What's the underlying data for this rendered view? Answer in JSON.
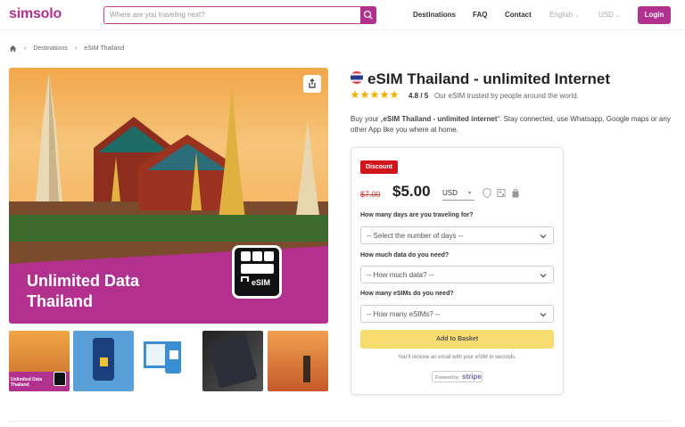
{
  "brand": {
    "logo": "simsolo"
  },
  "search": {
    "placeholder": "Where are you traveling next?"
  },
  "nav": {
    "destinations": "Destinations",
    "faq": "FAQ",
    "contact": "Contact",
    "language": "English",
    "currency": "USD",
    "login": "Login"
  },
  "breadcrumb": {
    "items": [
      "Destinations",
      "eSIM Thailand"
    ]
  },
  "hero": {
    "title_line1": "Unlimited Data",
    "title_line2": "Thailand",
    "card_label": "eSIM"
  },
  "thumbnails": {
    "first_label_line1": "Unlimited Data",
    "first_label_line2": "Thailand"
  },
  "product": {
    "title": "eSIM Thailand - unlimited Internet",
    "rating": "4.8 / 5",
    "rating_note": "Our eSIM trusted by people around the world.",
    "desc_prefix": "Buy your „",
    "desc_bold": "eSIM Thailand - unlimited internet",
    "desc_suffix": "“. Stay connected, use Whatsapp, Google maps or any other App like you where at home."
  },
  "purchase": {
    "badge": "Discount",
    "old_price": "$7.00",
    "price": "$5.00",
    "currency": "USD",
    "q_days": "How many days are you traveling for?",
    "sel_days": "-- Select the number of days --",
    "q_data": "How much data do you need?",
    "sel_data": "-- How much data? --",
    "q_esims": "How many eSIMs do you need?",
    "sel_esims": "-- How many eSIMs? --",
    "basket": "Add to Basket",
    "note": "You'll receive an email with your eSIM in seconds.",
    "powered": "Powered by",
    "stripe": "stripe"
  },
  "colors": {
    "accent": "#b2308e",
    "basket": "#f7dc6f",
    "discount": "#d0161c",
    "star": "#f5b301"
  }
}
